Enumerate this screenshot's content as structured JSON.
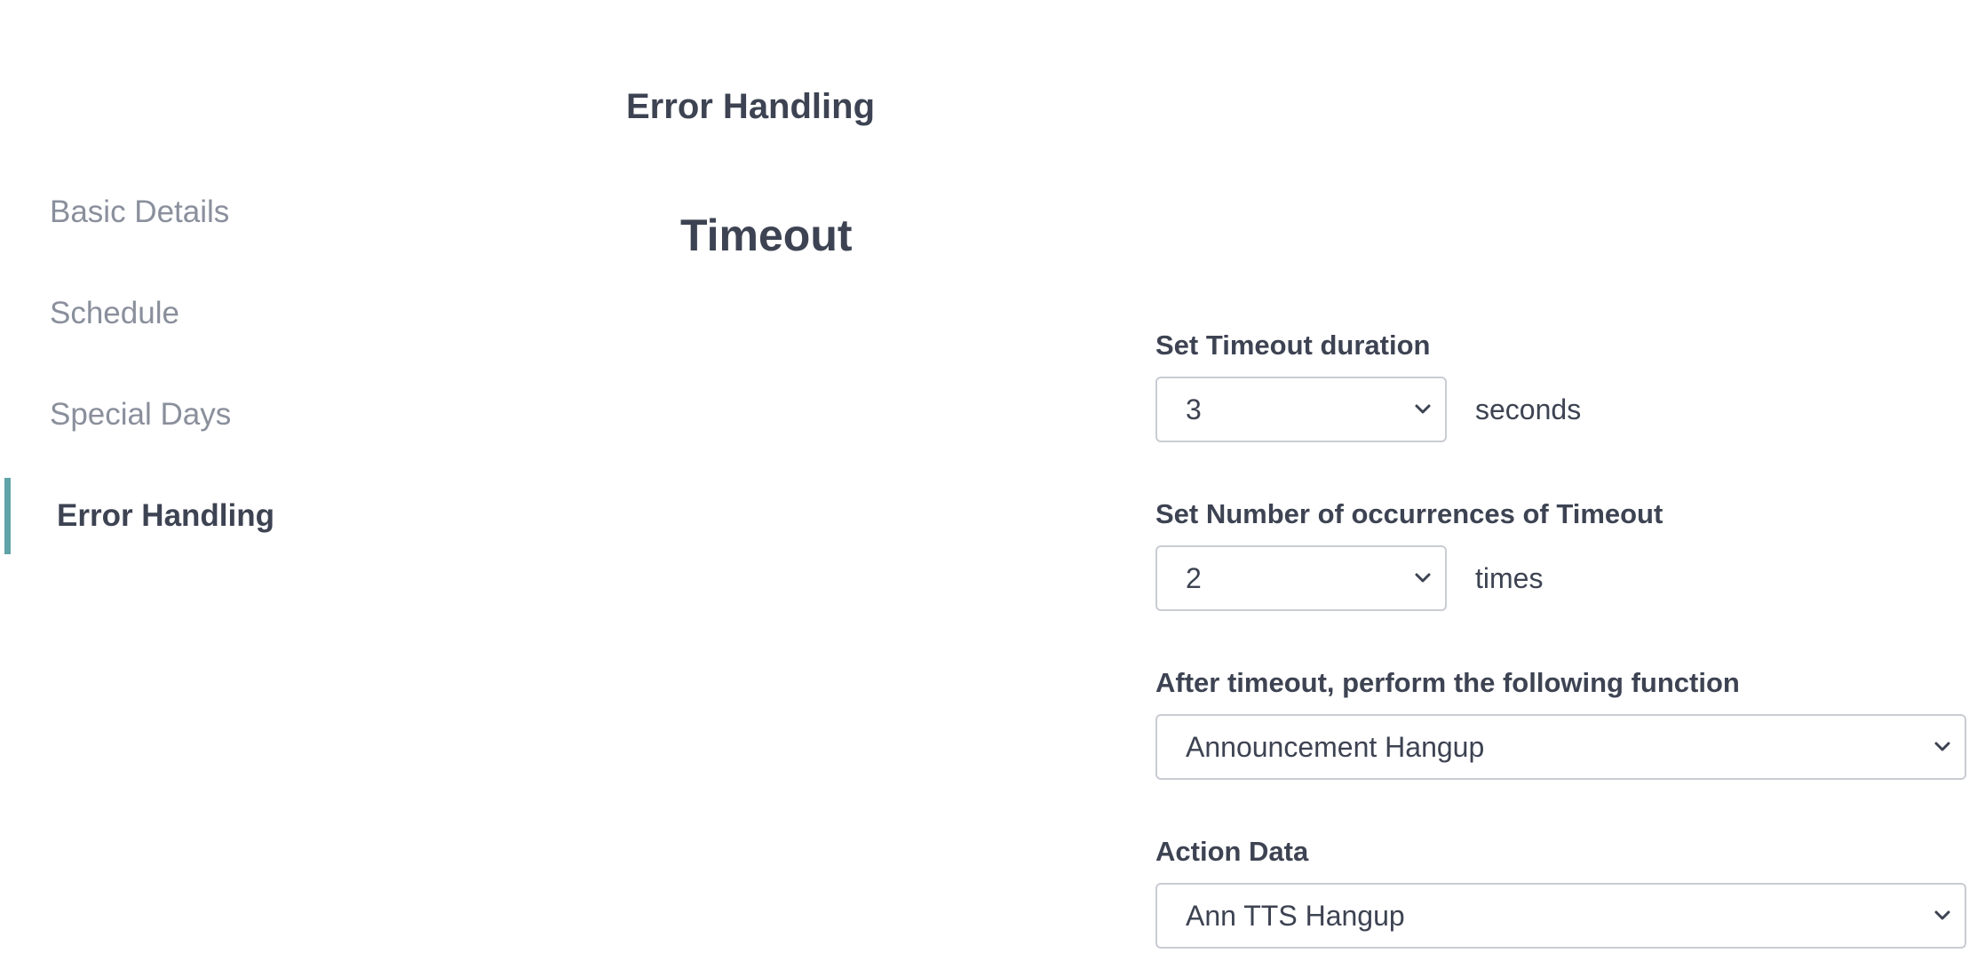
{
  "sidebar": {
    "items": [
      {
        "label": "Basic Details",
        "active": false
      },
      {
        "label": "Schedule",
        "active": false
      },
      {
        "label": "Special Days",
        "active": false
      },
      {
        "label": "Error Handling",
        "active": true
      }
    ],
    "accent_color": "#5fa3a8"
  },
  "main": {
    "section_title": "Error Handling",
    "subsection_title": "Timeout",
    "fields": {
      "timeout_duration": {
        "label": "Set Timeout duration",
        "value": "3",
        "unit": "seconds"
      },
      "timeout_occurrences": {
        "label": "Set Number of occurrences of Timeout",
        "value": "2",
        "unit": "times"
      },
      "after_timeout_function": {
        "label": "After timeout, perform the following function",
        "value": "Announcement Hangup"
      },
      "action_data": {
        "label": "Action Data",
        "value": "Ann TTS Hangup"
      }
    }
  },
  "icons": {
    "select_arrow": "chevron-down-icon"
  }
}
